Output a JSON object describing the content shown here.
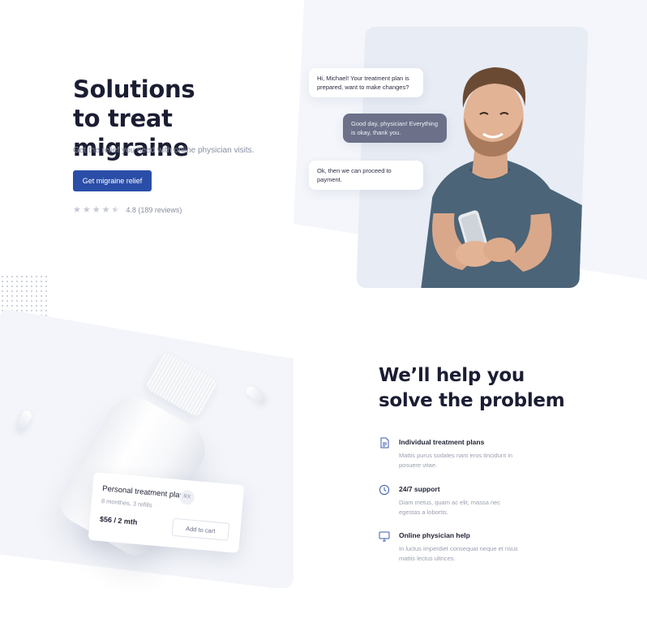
{
  "hero": {
    "title_line1": "Solutions",
    "title_line2": "to treat migraine",
    "subtitle": "Get the relief you need with online physician visits.",
    "cta_label": "Get migraine relief",
    "rating_value": 4.5,
    "rating_text": "4.8 (189 reviews)"
  },
  "chat": {
    "messages": [
      {
        "from": "app",
        "text": "Hi, Michael! Your treatment plan is prepared, want to make changes?"
      },
      {
        "from": "user",
        "text": "Good day, physician! Everything is okay, thank you."
      },
      {
        "from": "app",
        "text": "Ok, then we can proceed to payment."
      }
    ]
  },
  "plan_card": {
    "title": "Personal treatment plan",
    "badge": "RX",
    "details": "8 monthes, 3 refills",
    "price": "$56 / 2 mth",
    "cart_label": "Add to cart"
  },
  "help": {
    "title_line1": "We’ll help you",
    "title_line2": "solve the problem",
    "features": [
      {
        "icon": "document-icon",
        "name": "Individual treatment plans",
        "desc": "Mattis purus sodales nam eros tincidunt in posuere vitae."
      },
      {
        "icon": "clock-icon",
        "name": "24/7 support",
        "desc": "Diam metus, quam ac elit, massa nec egestas a lobortis."
      },
      {
        "icon": "monitor-icon",
        "name": "Online physician help",
        "desc": "In luctus imperdiet consequat neque et risus mattis lectus ultrices."
      }
    ]
  },
  "colors": {
    "accent": "#2a4ea8",
    "heading": "#1b1d33",
    "muted": "#8a8fa3",
    "bubble_user": "#6c7189",
    "icon": "#3b5bab"
  }
}
